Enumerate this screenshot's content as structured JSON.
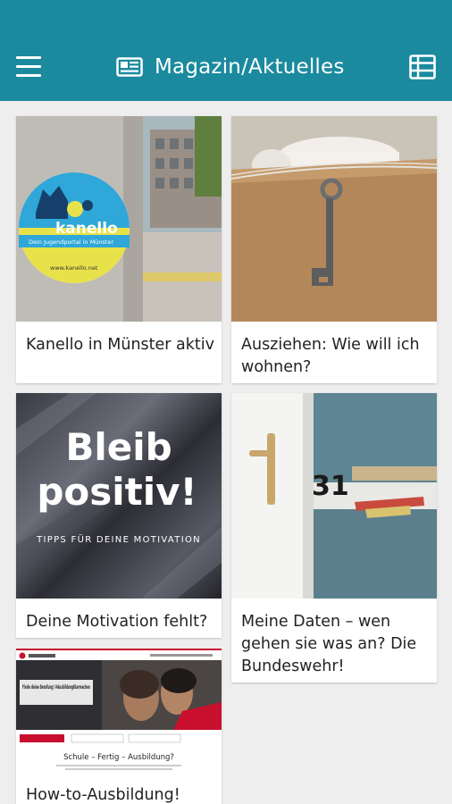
{
  "appbar": {
    "title": "Magazin/Aktuelles",
    "menu_icon": "hamburger-menu-icon",
    "title_icon": "newspaper-icon",
    "layout_icon": "grid-view-icon",
    "color": "#1b8a9e"
  },
  "articles": [
    {
      "title": "Kanello in Münster aktiv",
      "image": {
        "brand": "kanello",
        "tagline": "Dein Jugendportal in Münster",
        "url": "www.kanello.net"
      }
    },
    {
      "title": "Ausziehen: Wie will ich wohnen?"
    },
    {
      "title": "Deine Motivation fehlt?",
      "image": {
        "line1": "Bleib",
        "line2": "positiv!",
        "subline": "TIPPS FÜR DEINE MOTIVATION"
      }
    },
    {
      "title": "Meine Daten – wen gehen sie was an? Die Bundeswehr!",
      "image": {
        "door_number": "31"
      }
    },
    {
      "title": "How-to-Ausbildung!",
      "image": {
        "headline": "Finde deine Berufung! #AusbildungKlarmachen",
        "section_title": "Schule – Fertig – Ausbildung?"
      }
    }
  ]
}
